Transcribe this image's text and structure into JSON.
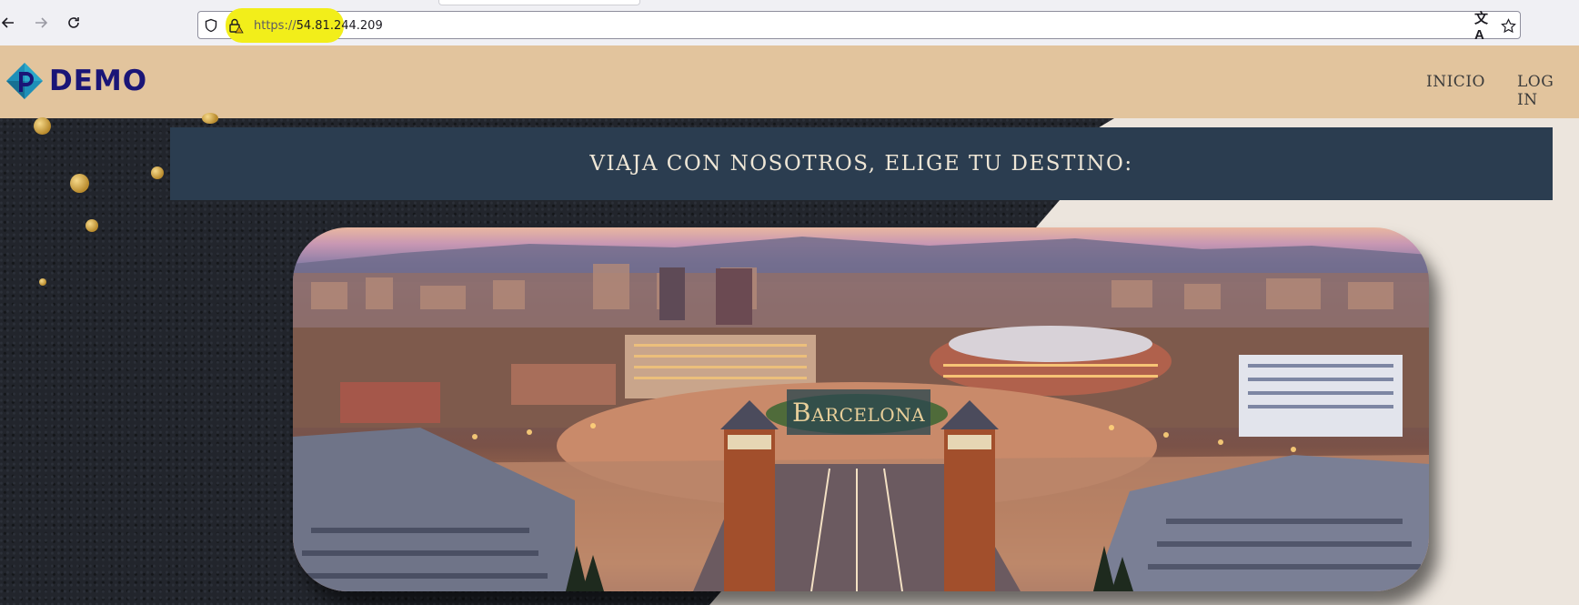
{
  "browser": {
    "url_scheme": "https://",
    "url_host": "54.81.244.209",
    "icons": [
      "back-arrow-icon",
      "forward-arrow-icon",
      "reload-icon",
      "shield-icon",
      "lock-warning-icon",
      "translate-icon",
      "star-icon"
    ]
  },
  "header": {
    "logo_text": "DEMO",
    "nav": [
      {
        "label": "INICIO"
      },
      {
        "label": "LOG IN"
      }
    ]
  },
  "banner": {
    "title": "VIAJA CON NOSOTROS, ELIGE TU DESTINO:"
  },
  "destinations": [
    {
      "name": "Barcelona"
    }
  ],
  "colors": {
    "header_bg": "#e2c49d",
    "banner_bg": "#2b3d50",
    "logo_text": "#1a1577",
    "url_highlight": "#f2ee1a"
  }
}
